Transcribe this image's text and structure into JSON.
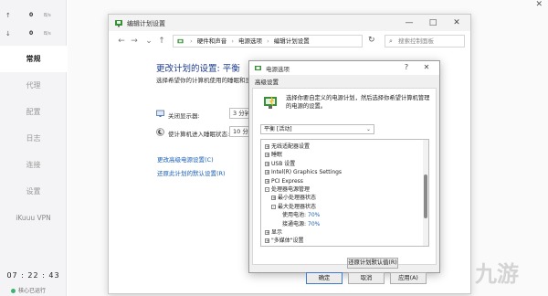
{
  "sidebar": {
    "upload": {
      "arrow": "↑",
      "value": "0",
      "unit": "B/s"
    },
    "download": {
      "arrow": "↓",
      "value": "0",
      "unit": "B/s"
    },
    "items": [
      {
        "label": "常规",
        "active": true
      },
      {
        "label": "代理"
      },
      {
        "label": "配置"
      },
      {
        "label": "日志"
      },
      {
        "label": "连接"
      },
      {
        "label": "设置"
      },
      {
        "label": "iKuuu VPN"
      }
    ],
    "clock": "07 : 22 : 43",
    "core_status": "核心已运行"
  },
  "top_close": "✕",
  "window": {
    "title": "编辑计划设置",
    "controls": {
      "minimize": "—",
      "maximize": "□",
      "close": "✕"
    },
    "breadcrumb": [
      "硬件和声音",
      "电源选项",
      "编辑计划设置"
    ],
    "search_placeholder": "搜索控制面板",
    "heading": "更改计划的设置: 平衡",
    "description": "选择希望你的计算机使用的睡眠和显示设置。",
    "settings": [
      {
        "label": "关闭显示器:",
        "value": "3 分钟"
      },
      {
        "label": "使计算机进入睡眠状态:",
        "value": "10 分钟"
      }
    ],
    "link_advanced": "更改高级电源设置(C)",
    "link_restore": "还原此计划的默认设置(R)"
  },
  "dialog": {
    "title": "电源选项",
    "controls": {
      "help": "?",
      "close": "✕"
    },
    "tab": "高级设置",
    "instructions": "选择你要自定义的电源计划，然后选择你希望计算机管理的电源的设置。",
    "plan": "平衡 [活动]",
    "tree": [
      {
        "indent": 0,
        "toggle": "+",
        "label": "无线适配器设置"
      },
      {
        "indent": 0,
        "toggle": "+",
        "label": "睡眠"
      },
      {
        "indent": 0,
        "toggle": "+",
        "label": "USB 设置"
      },
      {
        "indent": 0,
        "toggle": "+",
        "label": "Intel(R) Graphics Settings"
      },
      {
        "indent": 0,
        "toggle": "+",
        "label": "PCI Express"
      },
      {
        "indent": 0,
        "toggle": "-",
        "label": "处理器电源管理"
      },
      {
        "indent": 1,
        "toggle": "+",
        "label": "最小处理器状态"
      },
      {
        "indent": 1,
        "toggle": "-",
        "label": "最大处理器状态"
      },
      {
        "indent": 2,
        "toggle": "",
        "label": "使用电池:",
        "value": "70%"
      },
      {
        "indent": 2,
        "toggle": "",
        "label": "接通电源:",
        "value": "70%"
      },
      {
        "indent": 0,
        "toggle": "+",
        "label": "显示"
      },
      {
        "indent": 0,
        "toggle": "+",
        "label": "\"多媒体\"设置"
      }
    ],
    "restore_button": "还原计划默认值(R)",
    "ok_button": "确定",
    "cancel_button": "取消",
    "apply_button": "应用(A)"
  },
  "watermark": "九游"
}
